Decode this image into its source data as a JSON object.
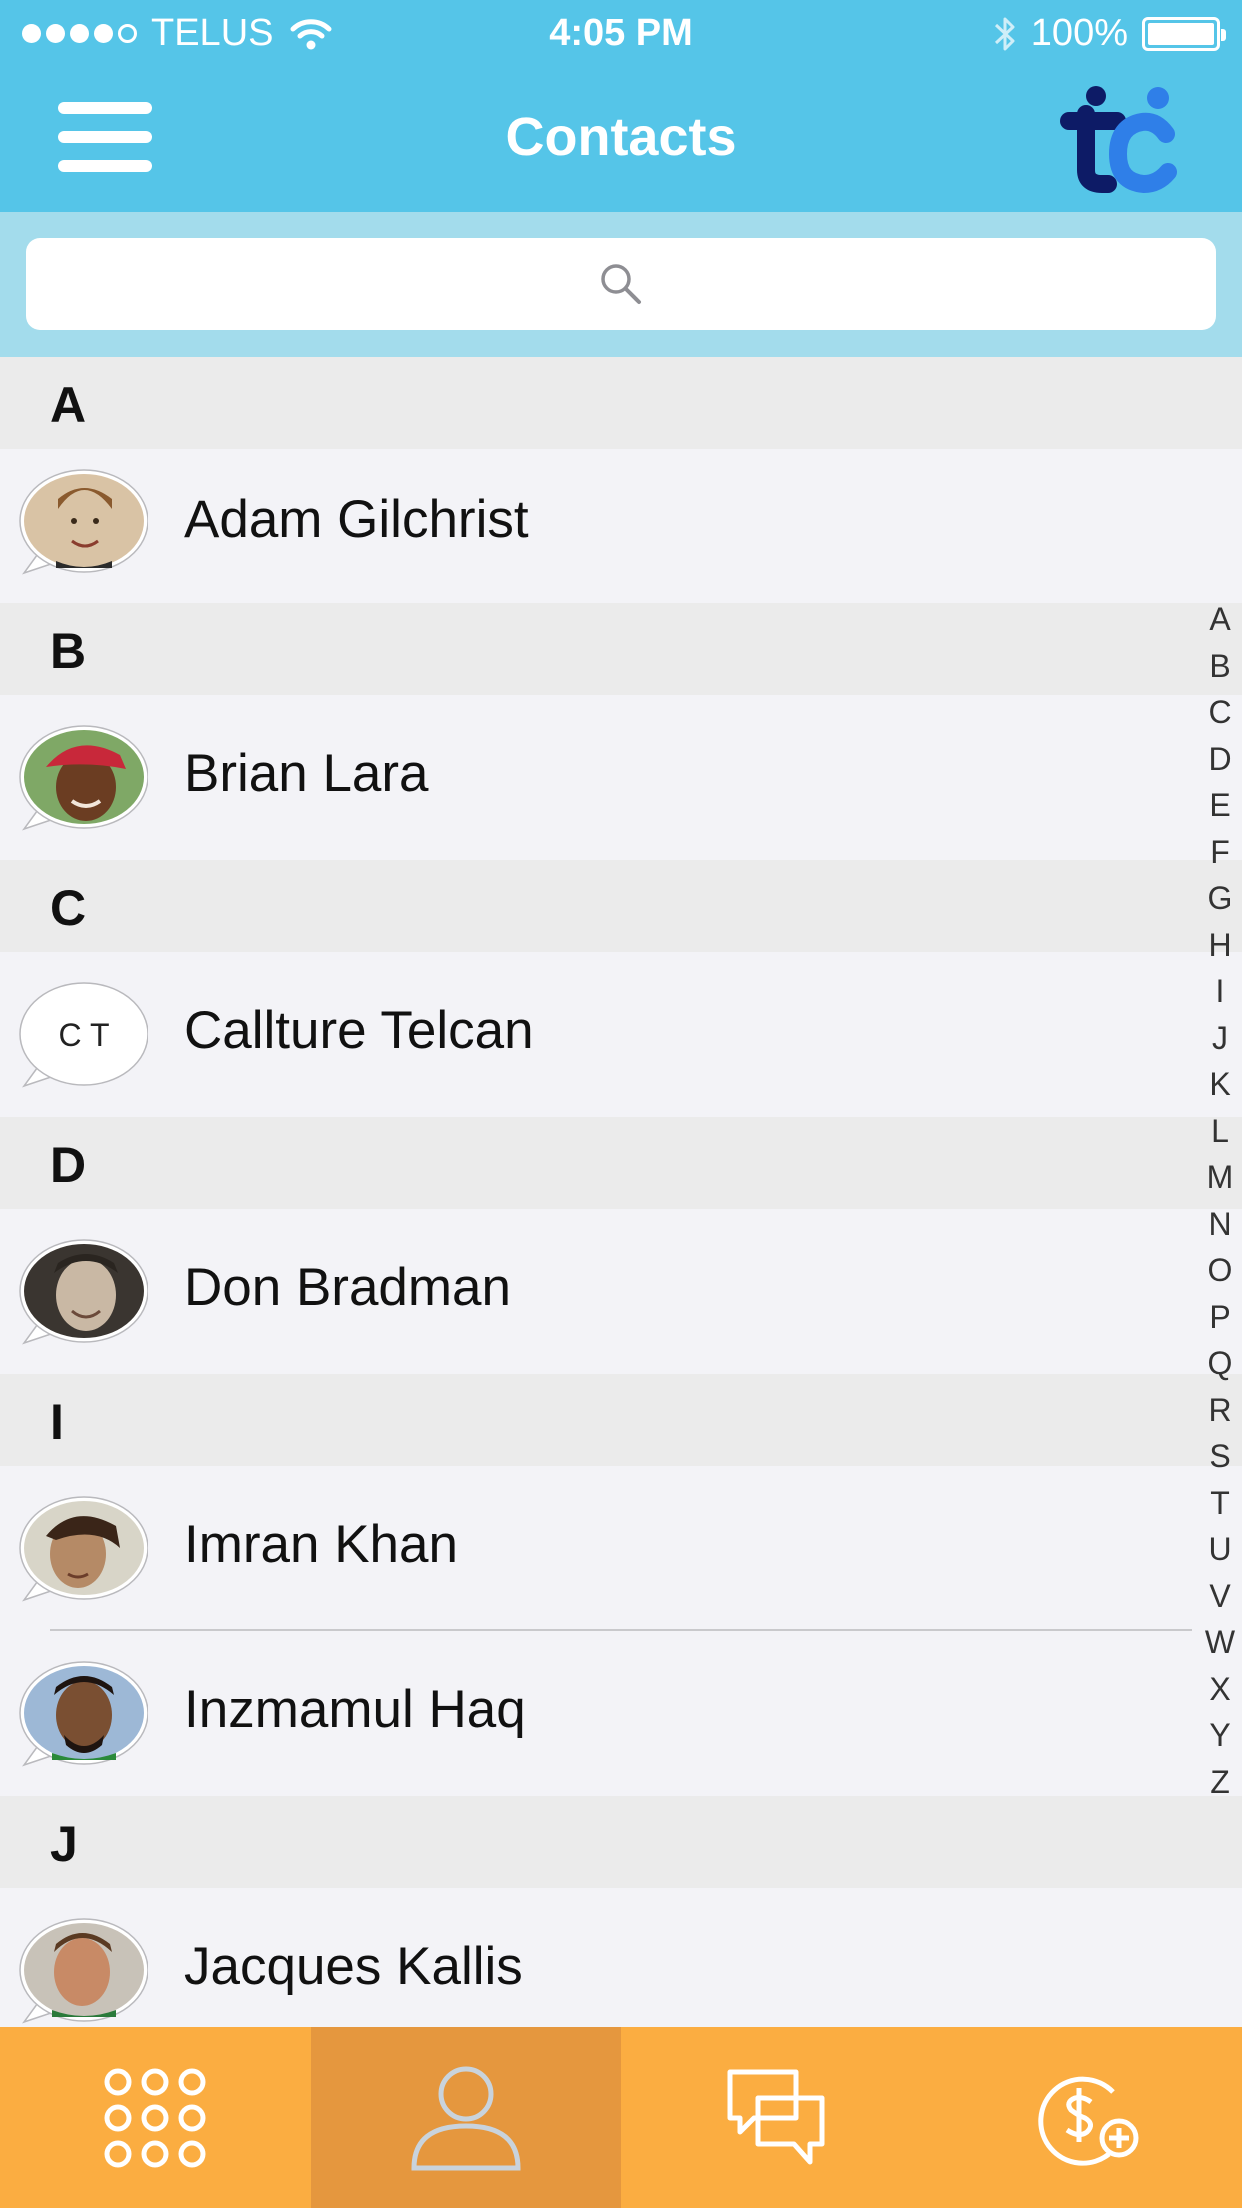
{
  "status_bar": {
    "carrier": "TELUS",
    "time": "4:05 PM",
    "battery": "100%"
  },
  "nav": {
    "title": "Contacts"
  },
  "search": {
    "placeholder": ""
  },
  "sections": [
    {
      "letter": "A",
      "contacts": [
        {
          "name": "Adam Gilchrist",
          "avatar": "photo",
          "initials": ""
        }
      ]
    },
    {
      "letter": "B",
      "contacts": [
        {
          "name": "Brian Lara",
          "avatar": "photo",
          "initials": ""
        }
      ]
    },
    {
      "letter": "C",
      "contacts": [
        {
          "name": "Callture Telcan",
          "avatar": "initials",
          "initials": "C T"
        }
      ]
    },
    {
      "letter": "D",
      "contacts": [
        {
          "name": "Don Bradman",
          "avatar": "photo",
          "initials": ""
        }
      ]
    },
    {
      "letter": "I",
      "contacts": [
        {
          "name": "Imran Khan",
          "avatar": "photo",
          "initials": ""
        },
        {
          "name": "Inzmamul Haq",
          "avatar": "photo",
          "initials": ""
        }
      ]
    },
    {
      "letter": "J",
      "contacts": [
        {
          "name": "Jacques Kallis",
          "avatar": "photo",
          "initials": ""
        }
      ]
    }
  ],
  "index": [
    "A",
    "B",
    "C",
    "D",
    "E",
    "F",
    "G",
    "H",
    "I",
    "J",
    "K",
    "L",
    "M",
    "N",
    "O",
    "P",
    "Q",
    "R",
    "S",
    "T",
    "U",
    "V",
    "W",
    "X",
    "Y",
    "Z"
  ],
  "tabs": [
    {
      "icon": "keypad-icon",
      "active": false
    },
    {
      "icon": "contacts-icon",
      "active": true
    },
    {
      "icon": "messages-icon",
      "active": false
    },
    {
      "icon": "add-credit-icon",
      "active": false
    }
  ],
  "colors": {
    "header": "#55c5e8",
    "search_bg": "#a3dcec",
    "tabbar": "#fbad41",
    "tab_active": "#e5973e",
    "logo_dark": "#0d1b66",
    "logo_blue": "#2f7fe8"
  }
}
